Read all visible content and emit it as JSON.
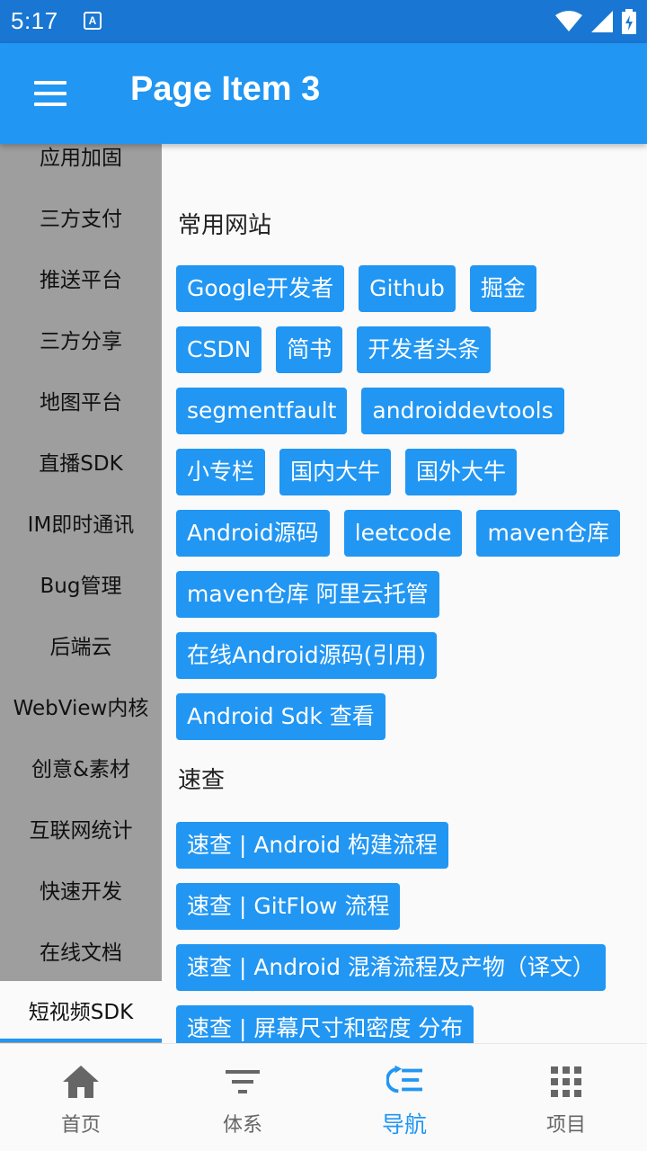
{
  "status_bar": {
    "time": "5:17",
    "notif_glyph": "A"
  },
  "app_bar": {
    "title": "Page Item 3"
  },
  "sidebar": {
    "items": [
      {
        "label": "应用加固"
      },
      {
        "label": "三方支付"
      },
      {
        "label": "推送平台"
      },
      {
        "label": "三方分享"
      },
      {
        "label": "地图平台"
      },
      {
        "label": "直播SDK"
      },
      {
        "label": "IM即时通讯"
      },
      {
        "label": "Bug管理"
      },
      {
        "label": "后端云"
      },
      {
        "label": "WebView内核"
      },
      {
        "label": "创意&素材"
      },
      {
        "label": "互联网统计"
      },
      {
        "label": "快速开发"
      },
      {
        "label": "在线文档"
      },
      {
        "label": "短视频SDK"
      }
    ],
    "active_index": 14
  },
  "content": {
    "sections": [
      {
        "title": "常用网站",
        "chips": [
          "Google开发者",
          "Github",
          "掘金",
          "CSDN",
          "简书",
          "开发者头条",
          "segmentfault",
          "androiddevtools",
          "小专栏",
          "国内大牛",
          "国外大牛",
          "Android源码",
          "leetcode",
          "maven仓库",
          "maven仓库 阿里云托管",
          "在线Android源码(引用)",
          "Android Sdk 查看"
        ]
      },
      {
        "title": "速查",
        "chips": [
          "速查 | Android 构建流程",
          "速查 | GitFlow 流程",
          "速查 | Android 混淆流程及产物（译文）",
          "速查 | 屏幕尺寸和密度 分布"
        ]
      }
    ]
  },
  "bottom_nav": {
    "items": [
      {
        "label": "首页",
        "icon": "home-icon"
      },
      {
        "label": "体系",
        "icon": "filter-icon"
      },
      {
        "label": "导航",
        "icon": "navigation-icon"
      },
      {
        "label": "项目",
        "icon": "apps-grid-icon"
      }
    ],
    "active_index": 2
  },
  "colors": {
    "primary": "#2196f3",
    "status_bar": "#1976d2",
    "sidebar_bg": "#9e9e9e"
  }
}
